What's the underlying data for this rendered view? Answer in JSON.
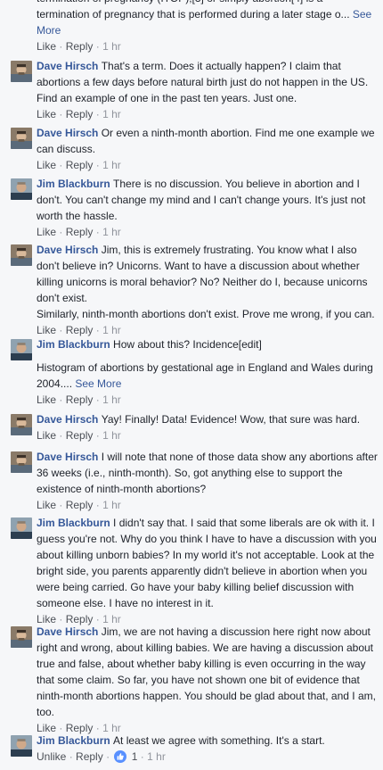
{
  "comments": [
    {
      "author": "",
      "paragraphs": [
        "termination of pregnancy (ITOP),[3] or simply abortion[4] is a termination of pregnancy that is performed during a later stage o..."
      ],
      "see_more": "See More",
      "like": "Like",
      "reply": "Reply",
      "time": "1 hr"
    },
    {
      "author": "Dave Hirsch",
      "paragraphs": [
        "That's a term. Does it actually happen? I claim that abortions a few days before natural birth just do not happen in the US. Find an example of one in the past ten years. Just one."
      ],
      "like": "Like",
      "reply": "Reply",
      "time": "1 hr"
    },
    {
      "author": "Dave Hirsch",
      "paragraphs": [
        "Or even a ninth-month abortion. Find me one example we can discuss."
      ],
      "like": "Like",
      "reply": "Reply",
      "time": "1 hr"
    },
    {
      "author": "Jim Blackburn",
      "paragraphs": [
        "There is no discussion. You believe in abortion and I don't. You can't change my mind and I can't change yours. It's just not worth the hassle."
      ],
      "like": "Like",
      "reply": "Reply",
      "time": "1 hr"
    },
    {
      "author": "Dave Hirsch",
      "paragraphs": [
        "Jim, this is extremely frustrating. You know what I also don't believe in? Unicorns. Want to have a discussion about whether killing unicorns is moral behavior? No? Neither do I, because unicorns don't exist.",
        "Similarly, ninth-month abortions don't exist. Prove me wrong, if you can."
      ],
      "like": "Like",
      "reply": "Reply",
      "time": "1 hr"
    },
    {
      "author": "Jim Blackburn",
      "paragraphs": [
        "How about this? Incidence[edit]",
        "Histogram of abortions by gestational age in England and Wales during 2004...."
      ],
      "see_more": "See More",
      "like": "Like",
      "reply": "Reply",
      "time": "1 hr"
    },
    {
      "author": "Dave Hirsch",
      "paragraphs": [
        "Yay! Finally! Data! Evidence! Wow, that sure was hard."
      ],
      "like": "Like",
      "reply": "Reply",
      "time": "1 hr"
    },
    {
      "author": "Dave Hirsch",
      "paragraphs": [
        "I will note that none of those data show any abortions after 36 weeks (i.e., ninth-month). So, got anything else to support the existence of ninth-month abortions?"
      ],
      "like": "Like",
      "reply": "Reply",
      "time": "1 hr"
    },
    {
      "author": "Jim Blackburn",
      "paragraphs": [
        "I didn't say that. I said that some liberals are ok with it. I guess you're not. Why do you think I have to have a discussion with you about killing unborn babies? In my world it's not acceptable. Look at the bright side, you parents apparently didn't believe in abortion when you were being carried. Go have your baby killing belief discussion with someone else. I have no interest in it."
      ],
      "like": "Like",
      "reply": "Reply",
      "time": "1 hr"
    },
    {
      "author": "Dave Hirsch",
      "paragraphs": [
        "Jim, we are not having a discussion here right now about right and wrong, about killing babies. We are having a discussion about true and false, about whether baby killing is even occurring in the way that some claim. So far, you have not shown one bit of evidence that ninth-month abortions happen. You should be glad about that, and I am, too."
      ],
      "like": "Like",
      "reply": "Reply",
      "time": "1 hr"
    },
    {
      "author": "Jim Blackburn",
      "paragraphs": [
        "At least we agree with something. It's a start."
      ],
      "like": "Unlike",
      "reply": "Reply",
      "reaction_icon": "thumbs-up-icon",
      "reaction_count": "1",
      "time": "1 hr"
    }
  ],
  "colors": {
    "background": "#f6f7f9",
    "author": "#365899",
    "body_text": "#1d2129",
    "action_link": "#4b4f56",
    "meta": "#90949c",
    "like_badge": "#5890ff"
  }
}
